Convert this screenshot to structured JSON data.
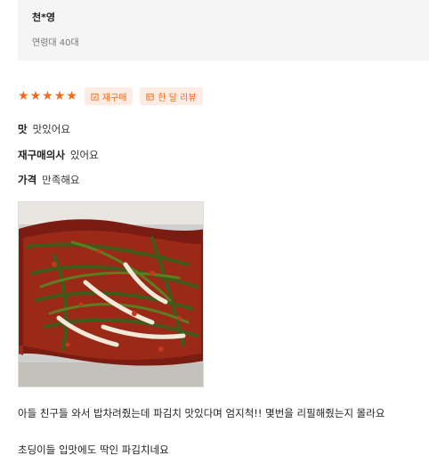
{
  "reviewer": {
    "name": "천*영",
    "meta": "연령대 40대"
  },
  "rating": {
    "stars": 5,
    "max": 5
  },
  "badges": [
    {
      "label": "재구매",
      "icon": "repurchase-icon"
    },
    {
      "label": "한 달 리뷰",
      "icon": "calendar-icon"
    }
  ],
  "attributes": [
    {
      "label": "맛",
      "value": "맛있어요"
    },
    {
      "label": "재구매의사",
      "value": "있어요"
    },
    {
      "label": "가격",
      "value": "만족해요"
    }
  ],
  "review": {
    "line1": "아들 친구들 와서 밥차려줬는데 파김치 맛있다며 엄지척!! 몇번을 리필해줬는지 몰라요",
    "line2": "초딩이들 입맛에도 딱인 파김치네요"
  },
  "colors": {
    "accent": "#f26a1b",
    "badge_bg": "#fdece3",
    "card_bg": "#f5f5f5"
  }
}
